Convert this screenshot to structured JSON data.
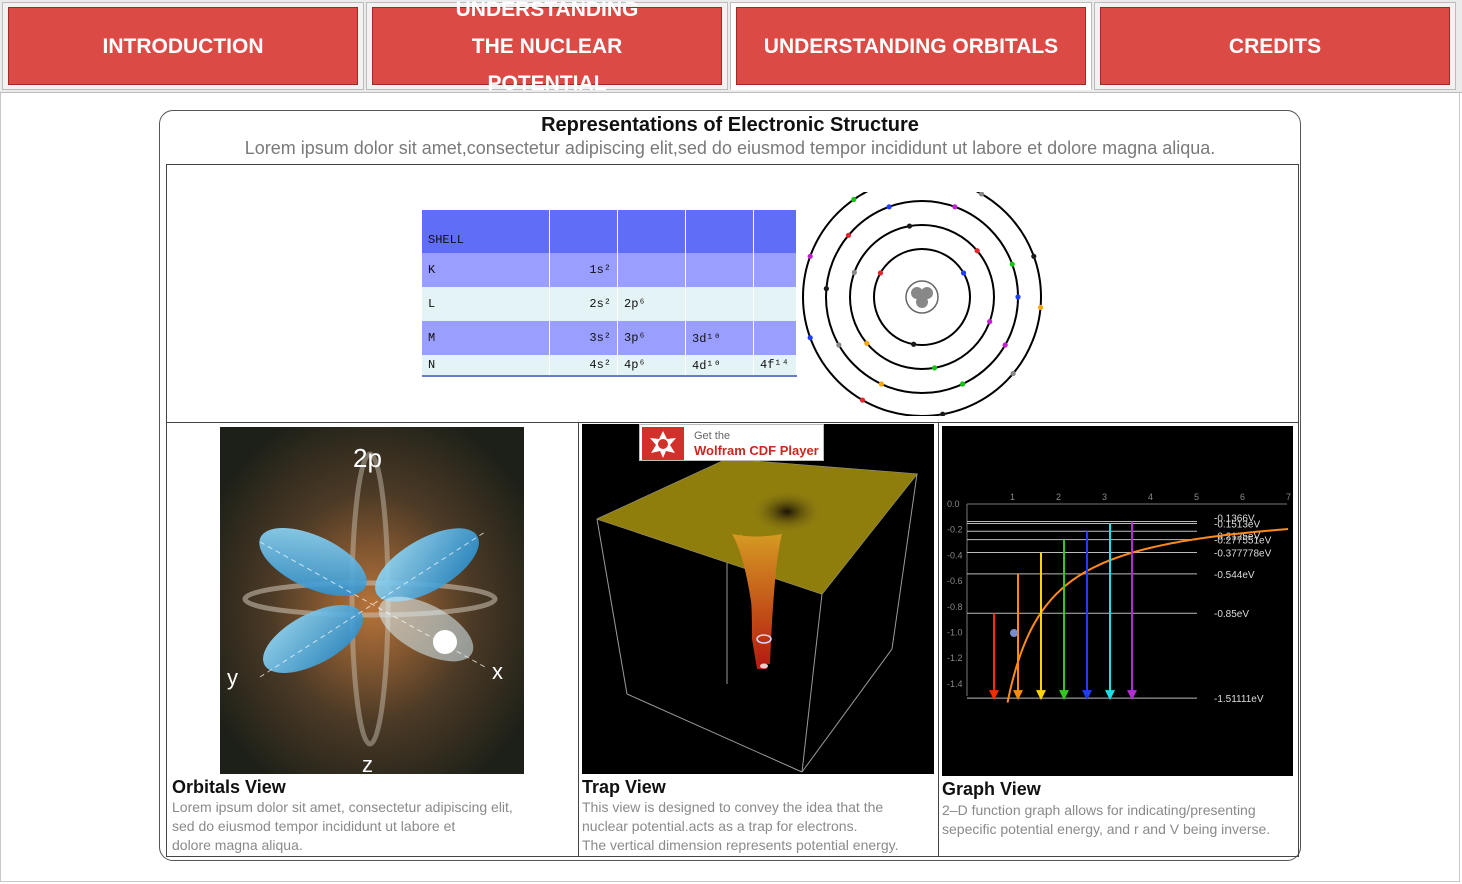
{
  "nav": [
    {
      "label": "INTRODUCTION"
    },
    {
      "label": "UNDERSTANDING THE NUCLEAR POTENTIAL"
    },
    {
      "label": "UNDERSTANDING ORBITALS"
    },
    {
      "label": "CREDITS"
    }
  ],
  "colors": {
    "nav_button": "#dc4a46",
    "table_header": "#5f6df7",
    "table_row_a": "#9a9eff",
    "table_row_b": "#e3f3f6",
    "accent_red": "#c8281f"
  },
  "panel": {
    "title": "Representations of Electronic Structure",
    "subtitle": "Lorem ipsum dolor sit amet,consectetur adipiscing elit,sed do eiusmod tempor incididunt ut labore et dolore magna aliqua."
  },
  "shell_table": {
    "header": "SHELL",
    "rows": [
      {
        "shell": "K",
        "cells": [
          "1s²",
          "",
          "",
          ""
        ]
      },
      {
        "shell": "L",
        "cells": [
          "2s²",
          "2p⁶",
          "",
          ""
        ]
      },
      {
        "shell": "M",
        "cells": [
          "3s²",
          "3p⁶",
          "3d¹⁰",
          ""
        ]
      },
      {
        "shell": "N",
        "cells": [
          "4s²",
          "4p⁶",
          "4d¹⁰",
          "4f¹⁴"
        ]
      }
    ]
  },
  "views": [
    {
      "title": "Orbitals View",
      "desc": [
        "Lorem ipsum dolor sit amet, consectetur adipiscing elit,",
        "sed do eiusmod tempor incididunt ut labore et",
        "dolore magna aliqua."
      ],
      "labels": {
        "orbital": "2p",
        "y": "y",
        "x": "x",
        "z": "z"
      }
    },
    {
      "title": "Trap View",
      "desc": [
        "This view is designed to convey the idea that the",
        "nuclear potential.acts as a trap for electrons.",
        "The vertical dimension represents potential energy."
      ],
      "badge_line1": "Get the",
      "badge_line2": "Wolfram CDF Player"
    },
    {
      "title": "Graph View",
      "desc": [
        "2–D function graph allows for indicating/presenting",
        "sepecific potential energy, and r and V being inverse."
      ]
    }
  ],
  "graph": {
    "x_ticks": [
      "1",
      "2",
      "3",
      "4",
      "5",
      "6",
      "7"
    ],
    "y_ticks": [
      "0.0",
      "-0.2",
      "-0.4",
      "-0.6",
      "-0.8",
      "-1.0",
      "-1.2",
      "-1.4"
    ],
    "level_labels": [
      "-0.1366V",
      "-0.1513eV",
      "-0.2125eV",
      "-0.277551eV",
      "-0.377778eV",
      "-0.544eV",
      "-0.85eV",
      "-1.51111eV"
    ],
    "arrow_colors": [
      "#ff2a00",
      "#ff8c00",
      "#ffd400",
      "#34c71f",
      "#1f3dff",
      "#19e1ea",
      "#b32cd6"
    ]
  }
}
